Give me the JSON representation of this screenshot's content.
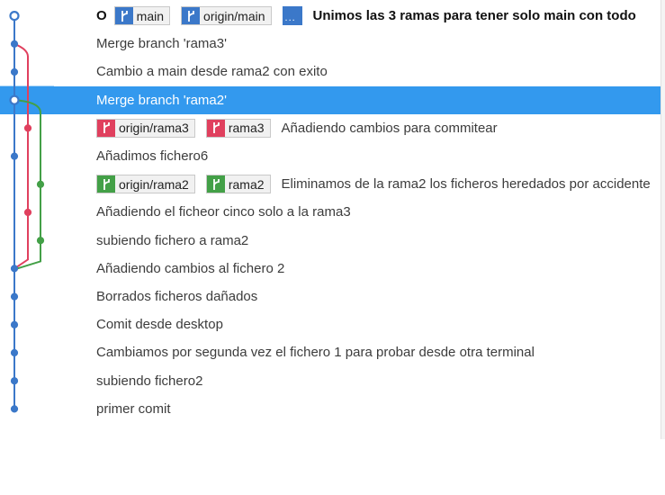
{
  "colors": {
    "main_line": "#3b78c9",
    "rama3_line": "#e0405e",
    "rama2_line": "#43a047",
    "selection": "#3399ee"
  },
  "commits": [
    {
      "message": "Unimos las 3 ramas para tener solo main con todo",
      "bold": true,
      "head_marker": "O",
      "refs": [
        {
          "label": "main",
          "color": "blue",
          "icon": "branch-icon"
        },
        {
          "label": "origin/main",
          "color": "blue",
          "icon": "branch-icon"
        },
        {
          "label": "",
          "color": "blue",
          "icon": "more-refs-icon",
          "dots": "..."
        }
      ]
    },
    {
      "message": "Merge branch 'rama3'",
      "refs": []
    },
    {
      "message": "Cambio a main desde rama2 con exito",
      "refs": []
    },
    {
      "message": "Merge branch 'rama2'",
      "selected": true,
      "refs": []
    },
    {
      "message": "Añadiendo cambios para commitear",
      "refs": [
        {
          "label": "origin/rama3",
          "color": "red",
          "icon": "branch-icon"
        },
        {
          "label": "rama3",
          "color": "red",
          "icon": "branch-icon"
        }
      ]
    },
    {
      "message": "Añadimos fichero6",
      "refs": []
    },
    {
      "message": "Eliminamos de la rama2 los ficheros heredados por accidente",
      "refs": [
        {
          "label": "origin/rama2",
          "color": "green",
          "icon": "branch-icon"
        },
        {
          "label": "rama2",
          "color": "green",
          "icon": "branch-icon"
        }
      ]
    },
    {
      "message": "Añadiendo el ficheor cinco solo a la rama3",
      "refs": []
    },
    {
      "message": "subiendo fichero a rama2",
      "refs": []
    },
    {
      "message": "Añadiendo cambios al fichero 2",
      "refs": []
    },
    {
      "message": "Borrados ficheros dañados",
      "refs": []
    },
    {
      "message": "Comit desde desktop",
      "refs": []
    },
    {
      "message": "Cambiamos por segunda vez el fichero 1 para probar desde otra terminal",
      "refs": []
    },
    {
      "message": "subiendo fichero2",
      "refs": []
    },
    {
      "message": "primer comit",
      "refs": []
    }
  ]
}
